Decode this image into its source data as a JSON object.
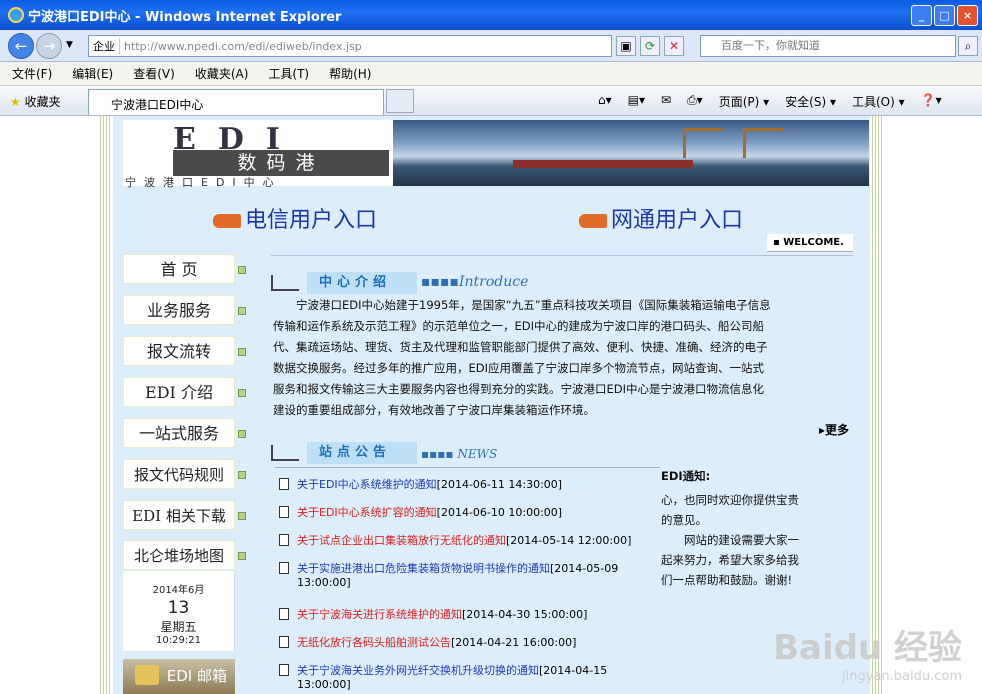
{
  "window": {
    "title": "宁波港口EDI中心 - Windows Internet Explorer",
    "min": "_",
    "max": "□",
    "close": "×"
  },
  "address": {
    "zone": "企业",
    "url": "http://www.npedi.com/edi/ediweb/index.jsp",
    "search_placeholder": "百度一下，你就知道"
  },
  "menu": [
    "文件(F)",
    "编辑(E)",
    "查看(V)",
    "收藏夹(A)",
    "工具(T)",
    "帮助(H)"
  ],
  "favorites_label": "收藏夹",
  "tab": {
    "label": "宁波港口EDI中心"
  },
  "tools": {
    "page": "页面(P) ▾",
    "safety": "安全(S) ▾",
    "tools": "工具(O) ▾",
    "help": "❓▾"
  },
  "banner": {
    "logo_text": "EDI",
    "logo_sub": "数码港",
    "tagline": "宁波港口EDI中心"
  },
  "entries": {
    "telecom": "电信用户入口",
    "netcom": "网通用户入口"
  },
  "welcome": "WELCOME.",
  "nav": [
    "首 页",
    "业务服务",
    "报文流转",
    "EDI 介绍",
    "一站式服务",
    "报文代码规则",
    "EDI 相关下载",
    "北仑堆场地图"
  ],
  "date": {
    "ym": "2014年6月",
    "day": "13",
    "weekday": "星期五",
    "time": "10:29:21"
  },
  "mail_label": "EDI 邮箱",
  "intro": {
    "title": "中心介绍",
    "en": "Introduce",
    "text": "宁波港口EDI中心始建于1995年，是国家“九五”重点科技攻关项目《国际集装箱运输电子信息传输和运作系统及示范工程》的示范单位之一，EDI中心的建成为宁波口岸的港口码头、船公司船代、集疏运场站、理货、货主及代理和监管职能部门提供了高效、便利、快捷、准确、经济的电子数据交换服务。经过多年的推广应用，EDI应用覆盖了宁波口岸多个物流节点，网站查询、一站式服务和报文传输这三大主要服务内容也得到充分的实践。宁波港口EDI中心是宁波港口物流信息化建设的重要组成部分，有效地改善了宁波口岸集装箱运作环境。",
    "more": "更多"
  },
  "news": {
    "title": "站点公告",
    "en": "NEWS",
    "items": [
      {
        "title": "关于EDI中心系统维护的通知",
        "date": "[2014-06-11 14:30:00]",
        "color": "blue"
      },
      {
        "title": "关于EDI中心系统扩容的通知",
        "date": "[2014-06-10 10:00:00]",
        "color": "red"
      },
      {
        "title": "关于试点企业出口集装箱放行无纸化的通知",
        "date": "[2014-05-14 12:00:00]",
        "color": "red"
      },
      {
        "title": "关于实施进港出口危险集装箱货物说明书操作的通知",
        "date": "[2014-05-09 13:00:00]",
        "color": "blue"
      },
      {
        "title": "关于宁波海关进行系统维护的通知",
        "date": "[2014-04-30 15:00:00]",
        "color": "red"
      },
      {
        "title": "无纸化放行各码头船舶测试公告",
        "date": "[2014-04-21 16:00:00]",
        "color": "red"
      },
      {
        "title": "关于宁波海关业务外网光纤交换机升级切换的通知",
        "date": "[2014-04-15 13:00:00]",
        "color": "blue"
      }
    ]
  },
  "notice": {
    "title": "EDI通知:",
    "text": "心，也同时欢迎你提供宝贵的意见。",
    "text2": "网站的建设需要大家一起来努力，希望大家多给我们一点帮助和鼓励。谢谢!"
  },
  "watermark": {
    "logo": "Baidu 经验",
    "url": "jingyan.baidu.com"
  }
}
